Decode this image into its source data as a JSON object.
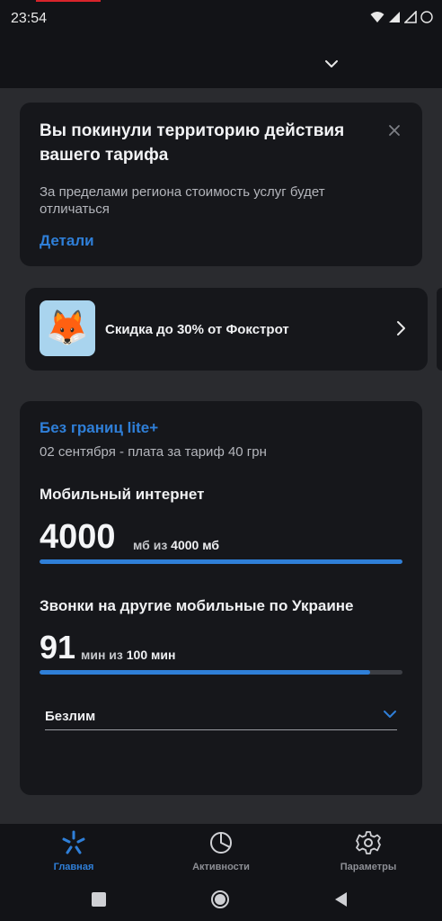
{
  "status_bar": {
    "time": "23:54"
  },
  "alert": {
    "title": "Вы покинули территорию действия вашего тарифа",
    "description": "За пределами региона стоимость услуг будет отличаться",
    "link": "Детали"
  },
  "promo": {
    "text": "Скидка до 30% от Фокстрот",
    "emoji": "🦊"
  },
  "plan": {
    "name": "Без границ lite+",
    "billing": "02 сентября - плата за тариф 40 грн",
    "internet": {
      "title": "Мобильный интернет",
      "remaining": "4000",
      "unit_prefix": "мб из",
      "total": "4000 мб",
      "fraction": 1.0
    },
    "calls": {
      "title": "Звонки на другие мобильные по Украине",
      "remaining": "91",
      "unit_prefix": "мин из",
      "total": "100 мин",
      "fraction": 0.91
    },
    "dropdown_value": "Безлим"
  },
  "tabs": [
    {
      "label": "Главная",
      "icon": "home-star-icon",
      "active": true
    },
    {
      "label": "Активности",
      "icon": "activity-pie-icon",
      "active": false
    },
    {
      "label": "Параметры",
      "icon": "settings-gear-icon",
      "active": false
    }
  ],
  "colors": {
    "accent": "#2f7fd8",
    "card": "#16171b",
    "background": "#2a2b2f"
  }
}
